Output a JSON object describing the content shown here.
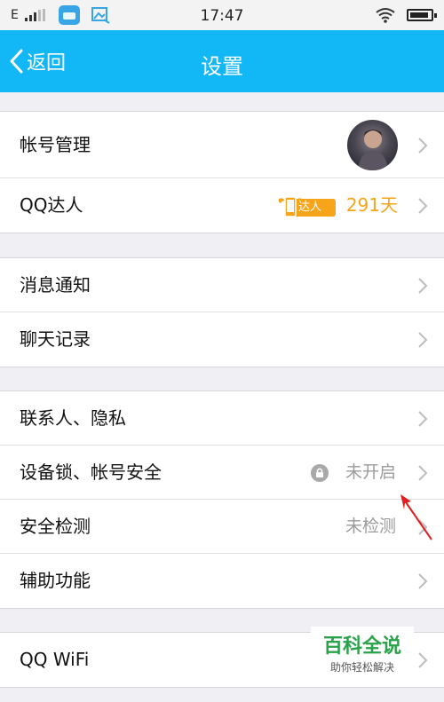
{
  "status_bar": {
    "network": "E",
    "time": "17:47"
  },
  "header": {
    "back_label": "返回",
    "title": "设置"
  },
  "groups": [
    {
      "items": [
        {
          "label": "帐号管理"
        },
        {
          "label": "QQ达人",
          "badge": "达人",
          "days": "291天"
        }
      ]
    },
    {
      "items": [
        {
          "label": "消息通知"
        },
        {
          "label": "聊天记录"
        }
      ]
    },
    {
      "items": [
        {
          "label": "联系人、隐私"
        },
        {
          "label": "设备锁、帐号安全",
          "status": "未开启"
        },
        {
          "label": "安全检测",
          "status": "未检测"
        },
        {
          "label": "辅助功能"
        }
      ]
    },
    {
      "items": [
        {
          "label": "QQ WiFi"
        }
      ]
    }
  ],
  "watermark": {
    "title": "百科全说",
    "subtitle": "助你轻松解决"
  },
  "colors": {
    "accent": "#12b7f5",
    "badge": "#f6a419",
    "annotation": "#e02020"
  }
}
